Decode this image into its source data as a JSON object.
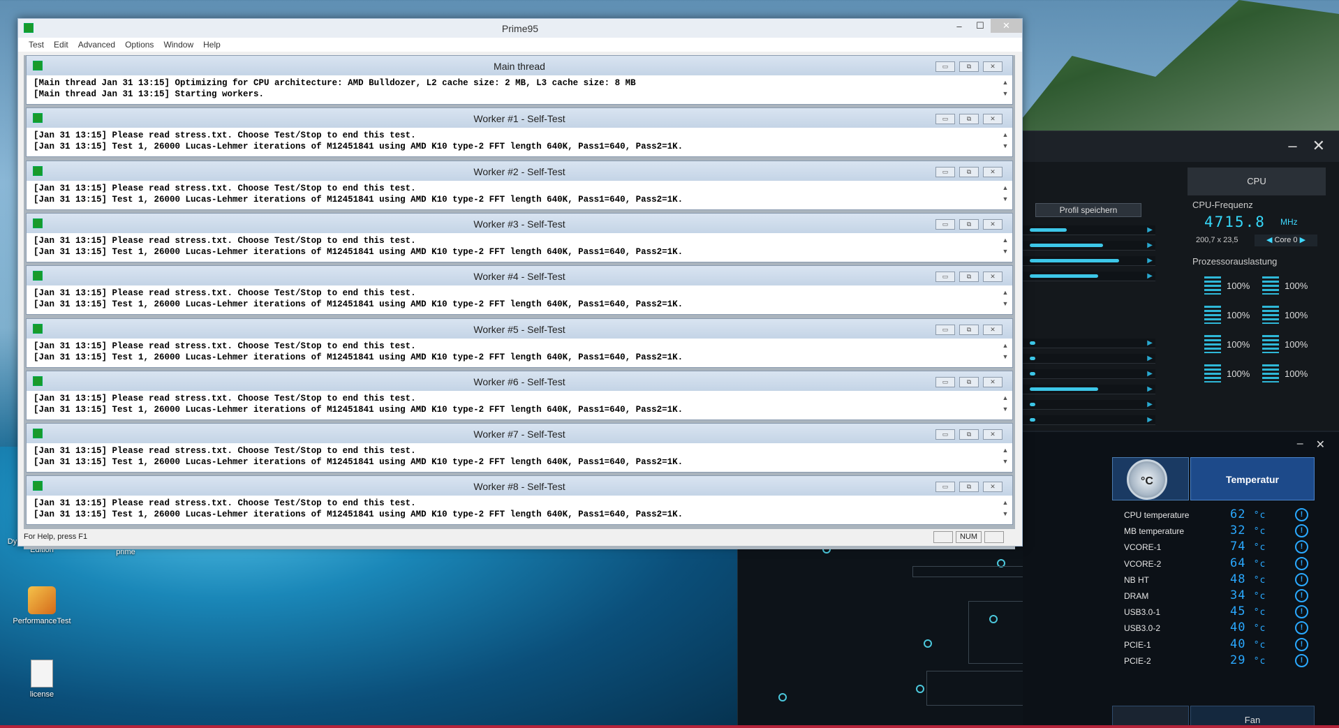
{
  "prime95": {
    "title": "Prime95",
    "menu": [
      "Test",
      "Edit",
      "Advanced",
      "Options",
      "Window",
      "Help"
    ],
    "status": "For Help, press F1",
    "num_indicator": "NUM",
    "windows": [
      {
        "title": "Main thread",
        "lines": [
          "[Main thread Jan 31 13:15] Optimizing for CPU architecture: AMD Bulldozer, L2 cache size: 2 MB, L3 cache size: 8 MB",
          "[Main thread Jan 31 13:15] Starting workers."
        ]
      },
      {
        "title": "Worker #1 - Self-Test",
        "lines": [
          "[Jan 31 13:15] Please read stress.txt.  Choose Test/Stop to end this test.",
          "[Jan 31 13:15] Test 1, 26000 Lucas-Lehmer iterations of M12451841 using AMD K10 type-2 FFT length 640K, Pass1=640, Pass2=1K."
        ]
      },
      {
        "title": "Worker #2 - Self-Test",
        "lines": [
          "[Jan 31 13:15] Please read stress.txt.  Choose Test/Stop to end this test.",
          "[Jan 31 13:15] Test 1, 26000 Lucas-Lehmer iterations of M12451841 using AMD K10 type-2 FFT length 640K, Pass1=640, Pass2=1K."
        ]
      },
      {
        "title": "Worker #3 - Self-Test",
        "lines": [
          "[Jan 31 13:15] Please read stress.txt.  Choose Test/Stop to end this test.",
          "[Jan 31 13:15] Test 1, 26000 Lucas-Lehmer iterations of M12451841 using AMD K10 type-2 FFT length 640K, Pass1=640, Pass2=1K."
        ]
      },
      {
        "title": "Worker #4 - Self-Test",
        "lines": [
          "[Jan 31 13:15] Please read stress.txt.  Choose Test/Stop to end this test.",
          "[Jan 31 13:15] Test 1, 26000 Lucas-Lehmer iterations of M12451841 using AMD K10 type-2 FFT length 640K, Pass1=640, Pass2=1K."
        ]
      },
      {
        "title": "Worker #5 - Self-Test",
        "lines": [
          "[Jan 31 13:15] Please read stress.txt.  Choose Test/Stop to end this test.",
          "[Jan 31 13:15] Test 1, 26000 Lucas-Lehmer iterations of M12451841 using AMD K10 type-2 FFT length 640K, Pass1=640, Pass2=1K."
        ]
      },
      {
        "title": "Worker #6 - Self-Test",
        "lines": [
          "[Jan 31 13:15] Please read stress.txt.  Choose Test/Stop to end this test.",
          "[Jan 31 13:15] Test 1, 26000 Lucas-Lehmer iterations of M12451841 using AMD K10 type-2 FFT length 640K, Pass1=640, Pass2=1K."
        ]
      },
      {
        "title": "Worker #7 - Self-Test",
        "lines": [
          "[Jan 31 13:15] Please read stress.txt.  Choose Test/Stop to end this test.",
          "[Jan 31 13:15] Test 1, 26000 Lucas-Lehmer iterations of M12451841 using AMD K10 type-2 FFT length 640K, Pass1=640, Pass2=1K."
        ]
      },
      {
        "title": "Worker #8 - Self-Test",
        "lines": [
          "[Jan 31 13:15] Please read stress.txt.  Choose Test/Stop to end this test.",
          "[Jan 31 13:15] Test 1, 26000 Lucas-Lehmer iterations of M12451841 using AMD K10 type-2 FFT length 640K, Pass1=640, Pass2=1K."
        ]
      }
    ]
  },
  "desktop": {
    "icons": [
      {
        "label": "Dying Light Ultimate Edition"
      },
      {
        "label": "prime"
      },
      {
        "label": "PerformanceTest"
      },
      {
        "label": "license"
      }
    ]
  },
  "ai_suite": {
    "profile_button": "Profil speichern",
    "cpu_tab": "CPU",
    "cpu_freq_label": "CPU-Frequenz",
    "cpu_freq_value": "4715.8",
    "cpu_freq_unit": "MHz",
    "multiplier": "200,7 x 23,5",
    "core_select": "Core 0",
    "load_label": "Prozessorauslastung",
    "loads": [
      "100%",
      "100%",
      "100%",
      "100%",
      "100%",
      "100%",
      "100%",
      "100%"
    ],
    "slider_levels": [
      0.35,
      0.7,
      0.85,
      0.65
    ],
    "lower_slider_levels": [
      0.05,
      0.05,
      0.05,
      0.65,
      0.05,
      0.05
    ]
  },
  "temperature": {
    "title": "Temperatur",
    "unit": "°c",
    "fan_tab": "Fan",
    "sensors": [
      {
        "name": "CPU temperature",
        "value": "62"
      },
      {
        "name": "MB temperature",
        "value": "32"
      },
      {
        "name": "VCORE-1",
        "value": "74"
      },
      {
        "name": "VCORE-2",
        "value": "64"
      },
      {
        "name": "NB HT",
        "value": "48"
      },
      {
        "name": "DRAM",
        "value": "34"
      },
      {
        "name": "USB3.0-1",
        "value": "45"
      },
      {
        "name": "USB3.0-2",
        "value": "40"
      },
      {
        "name": "PCIE-1",
        "value": "40"
      },
      {
        "name": "PCIE-2",
        "value": "29"
      }
    ]
  }
}
